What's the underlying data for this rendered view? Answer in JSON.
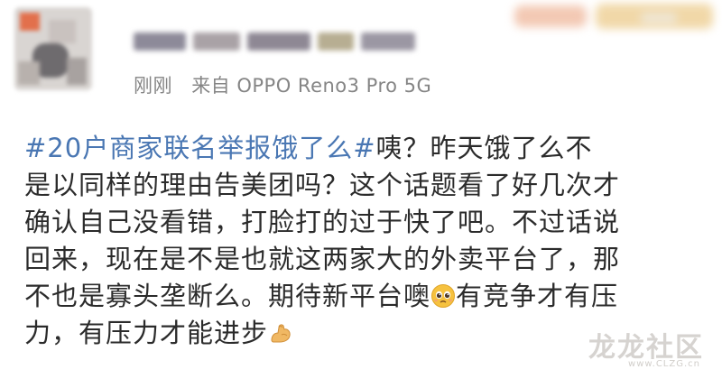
{
  "post": {
    "meta": {
      "time": "刚刚",
      "source": "来自 OPPO Reno3 Pro 5G"
    },
    "content": {
      "hashtag": "#20户商家联名举报饿了么#",
      "line1_rest": "咦？昨天饿了么不",
      "line2": "是以同样的理由告美团吗？这个话题看了好几次才",
      "line3": "确认自己没看错，打脸打的过于快了吧。不过话说",
      "line4": "回来，现在是不是也就这两家大的外卖平台了，那",
      "line5_a": "不也是寡头垄断么。期待新平台噢",
      "line5_b": "有竞争才有压",
      "line6": "力，有压力才能进步"
    },
    "icons": {
      "emoji1": "pleading-face-icon",
      "emoji2": "flexed-biceps-icon"
    },
    "colors": {
      "hashtag": "#4a77b3",
      "text": "#2b2b2b",
      "meta": "#858585"
    }
  },
  "watermark": {
    "text": "龙龙社区",
    "url": "www.CLZG.cn"
  }
}
